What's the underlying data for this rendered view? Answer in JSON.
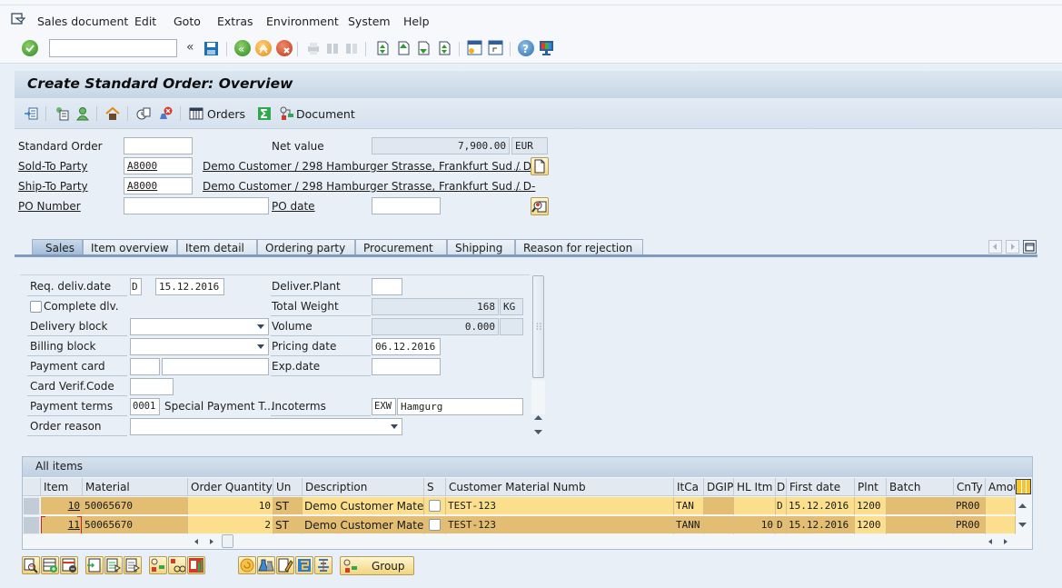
{
  "menu": {
    "items": [
      {
        "label": "Sales document"
      },
      {
        "label": "Edit"
      },
      {
        "label": "Goto"
      },
      {
        "label": "Extras"
      },
      {
        "label": "Environment"
      },
      {
        "label": "System"
      },
      {
        "label": "Help"
      }
    ]
  },
  "toolbar": {
    "command_field": "",
    "collapse_label": "«"
  },
  "title": "Create Standard Order: Overview",
  "appbar": {
    "orders_label": "Orders",
    "document_label": "Document"
  },
  "header": {
    "standard_order": {
      "label": "Standard Order",
      "value": ""
    },
    "net_value": {
      "label": "Net value",
      "value": "7,900.00",
      "currency": "EUR"
    },
    "sold_to": {
      "label": "Sold-To Party",
      "value": "A8000",
      "address": "Demo Customer / 298 Hamburger Strasse, Frankfurt Sud / D-"
    },
    "ship_to": {
      "label": "Ship-To Party",
      "value": "A8000",
      "address": "Demo Customer / 298 Hamburger Strasse, Frankfurt Sud / D-"
    },
    "po_number": {
      "label": "PO Number",
      "value": ""
    },
    "po_date": {
      "label": "PO date",
      "value": ""
    },
    "ellipsis": "..."
  },
  "tabs": [
    {
      "label": "Sales",
      "active": true
    },
    {
      "label": "Item overview"
    },
    {
      "label": "Item detail"
    },
    {
      "label": "Ordering party"
    },
    {
      "label": "Procurement"
    },
    {
      "label": "Shipping"
    },
    {
      "label": "Reason for rejection"
    }
  ],
  "sales": {
    "req_deliv_date": {
      "label": "Req. deliv.date",
      "type": "D",
      "value": "15.12.2016"
    },
    "complete_dlv": {
      "label": "Complete dlv.",
      "checked": false
    },
    "delivery_block": {
      "label": "Delivery block",
      "value": ""
    },
    "billing_block": {
      "label": "Billing block",
      "value": ""
    },
    "payment_card": {
      "label": "Payment card",
      "value1": "",
      "value2": ""
    },
    "card_verif": {
      "label": "Card Verif.Code",
      "value": ""
    },
    "payment_terms": {
      "label": "Payment terms",
      "value": "0001",
      "text": "Special Payment T..."
    },
    "order_reason": {
      "label": "Order reason",
      "value": ""
    },
    "deliver_plant": {
      "label": "Deliver.Plant",
      "value": ""
    },
    "total_weight": {
      "label": "Total Weight",
      "value": "168",
      "unit": "KG"
    },
    "volume": {
      "label": "Volume",
      "value": "0.000",
      "unit": ""
    },
    "pricing_date": {
      "label": "Pricing date",
      "value": "06.12.2016"
    },
    "exp_date": {
      "label": "Exp.date",
      "value": ""
    },
    "incoterms": {
      "label": "Incoterms",
      "code": "EXW",
      "value": "Hamgurg"
    }
  },
  "items": {
    "title": "All items",
    "columns": [
      "Item",
      "Material",
      "Order Quantity",
      "Un",
      "Description",
      "S",
      "Customer Material Numb",
      "ItCa",
      "DGIP",
      "HL Itm",
      "D",
      "First date",
      "Plnt",
      "Batch",
      "CnTy",
      "Amou"
    ],
    "rows": [
      {
        "item": "10",
        "material": "50065670",
        "qty": "10",
        "un": "ST",
        "desc": "Demo Customer Mater...",
        "s": false,
        "cust_mat": "TEST-123",
        "itca": "TAN",
        "dgip": "",
        "hl_itm": "",
        "d": "D",
        "first_date": "15.12.2016",
        "plnt": "1200",
        "batch": "",
        "cnty": "PR00",
        "amou": ""
      },
      {
        "item": "11",
        "material": "50065670",
        "qty": "2",
        "un": "ST",
        "desc": "Demo Customer Mater...",
        "s": false,
        "cust_mat": "TEST-123",
        "itca": "TANN",
        "dgip": "",
        "hl_itm": "10",
        "d": "D",
        "first_date": "15.12.2016",
        "plnt": "1200",
        "batch": "",
        "cnty": "PR00",
        "amou": ""
      }
    ]
  },
  "bottom": {
    "group_label": "Group"
  }
}
